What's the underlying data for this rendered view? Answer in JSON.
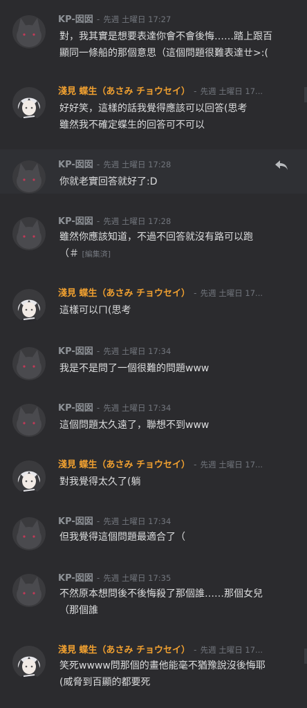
{
  "users": {
    "kp": "KP-囡囡",
    "asami": "淺見 蝶生（あさみ チョウセイ）"
  },
  "separator": "-",
  "timestamps": {
    "t1727": "先週 土曜日 17:27",
    "t1728": "先週 土曜日 17:28",
    "t1734": "先週 土曜日 17:34",
    "t1735": "先週 土曜日 17:35",
    "truncated": "先週 土曜日 17..."
  },
  "messages": [
    {
      "lines": [
        "對，我其實是想要表達你會不會後悔……踏上跟百",
        "顯同一條船的那個意思（這個問題很難表達ㄝ>:("
      ]
    },
    {
      "lines": [
        "好好笑，這樣的話我覺得應該可以回答(思考",
        "雖然我不確定蝶生的回答可不可以"
      ]
    },
    {
      "lines": [
        "你就老實回答就好了:D"
      ]
    },
    {
      "lines": [
        "雖然你應該知道，不過不回答就沒有路可以跑",
        "（＃"
      ],
      "edited": "[編集済]"
    },
    {
      "lines": [
        "這樣可以ㄇ(思考"
      ]
    },
    {
      "lines": [
        "我是不是問了一個很難的問題www"
      ]
    },
    {
      "lines": [
        "這個問題太久遠了，聯想不到www"
      ]
    },
    {
      "lines": [
        "對我覺得太久了(躺"
      ]
    },
    {
      "lines": [
        "但我覺得這個問題最適合了（"
      ]
    },
    {
      "lines": [
        "不然原本想問後不後悔殺了那個誰……那個女兒",
        "（那個誰"
      ]
    },
    {
      "lines": [
        "笑死wwww問那個的畫他能毫不猶豫說沒後悔耶",
        "(威脅到百顯的都要死"
      ]
    }
  ],
  "colors": {
    "background": "#2b2b2e",
    "kp_name": "#8e9297",
    "asami_name": "#f0a030",
    "text": "#dcddde",
    "muted": "#72767d"
  }
}
